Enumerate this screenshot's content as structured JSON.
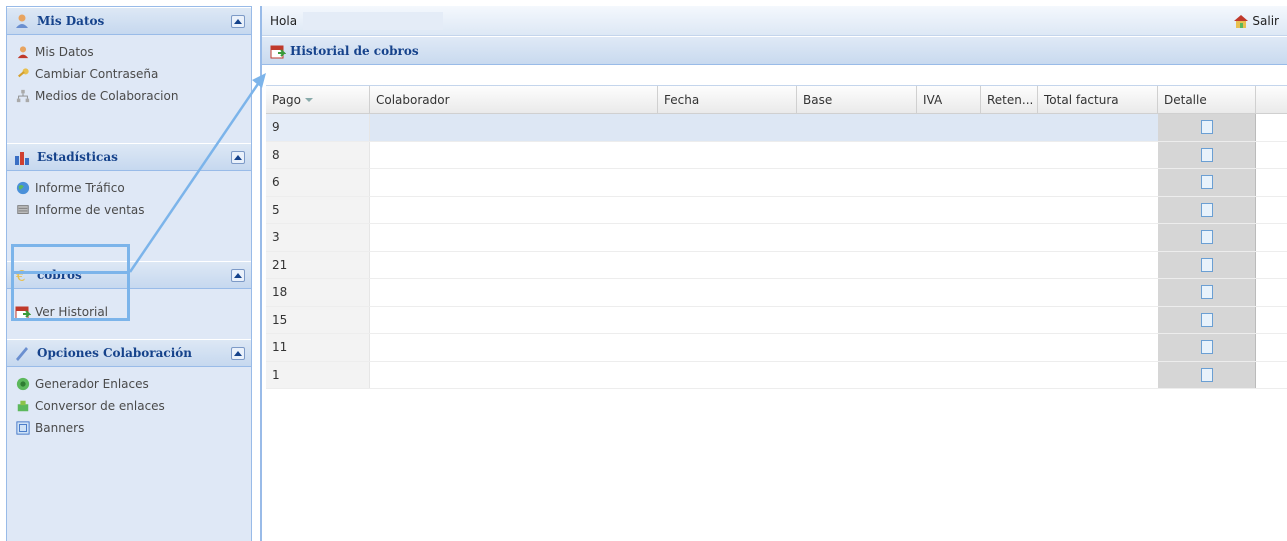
{
  "sidebar": {
    "panels": [
      {
        "title": "Mis Datos",
        "icon": "user-icon",
        "items": [
          {
            "label": "Mis Datos",
            "icon": "user-icon"
          },
          {
            "label": "Cambiar Contraseña",
            "icon": "key-icon"
          },
          {
            "label": "Medios de Colaboracion",
            "icon": "sitemap-icon"
          }
        ]
      },
      {
        "title": "Estadísticas",
        "icon": "bar-chart-icon",
        "items": [
          {
            "label": "Informe Tráfico",
            "icon": "globe-icon"
          },
          {
            "label": "Informe de ventas",
            "icon": "cart-icon"
          }
        ]
      },
      {
        "title": "cobros",
        "icon": "euro-icon",
        "items": [
          {
            "label": "Ver Historial",
            "icon": "calendar-icon"
          }
        ]
      },
      {
        "title": "Opciones Colaboración",
        "icon": "pen-icon",
        "items": [
          {
            "label": "Generador Enlaces",
            "icon": "link-globe-icon"
          },
          {
            "label": "Conversor de enlaces",
            "icon": "convert-icon"
          },
          {
            "label": "Banners",
            "icon": "banner-icon"
          }
        ]
      }
    ]
  },
  "topbar": {
    "greeting": "Hola",
    "logout": "Salir"
  },
  "section": {
    "title": "Historial de cobros"
  },
  "grid": {
    "columns": [
      "Pago",
      "Colaborador",
      "Fecha",
      "Base",
      "IVA",
      "Reten...",
      "Total factura",
      "Detalle"
    ],
    "rows": [
      "9",
      "8",
      "6",
      "5",
      "3",
      "21",
      "18",
      "15",
      "11",
      "1"
    ]
  },
  "colors": {
    "accent": "#15428b",
    "highlight": "#7cb4ea",
    "panel": "#dfe8f6"
  }
}
